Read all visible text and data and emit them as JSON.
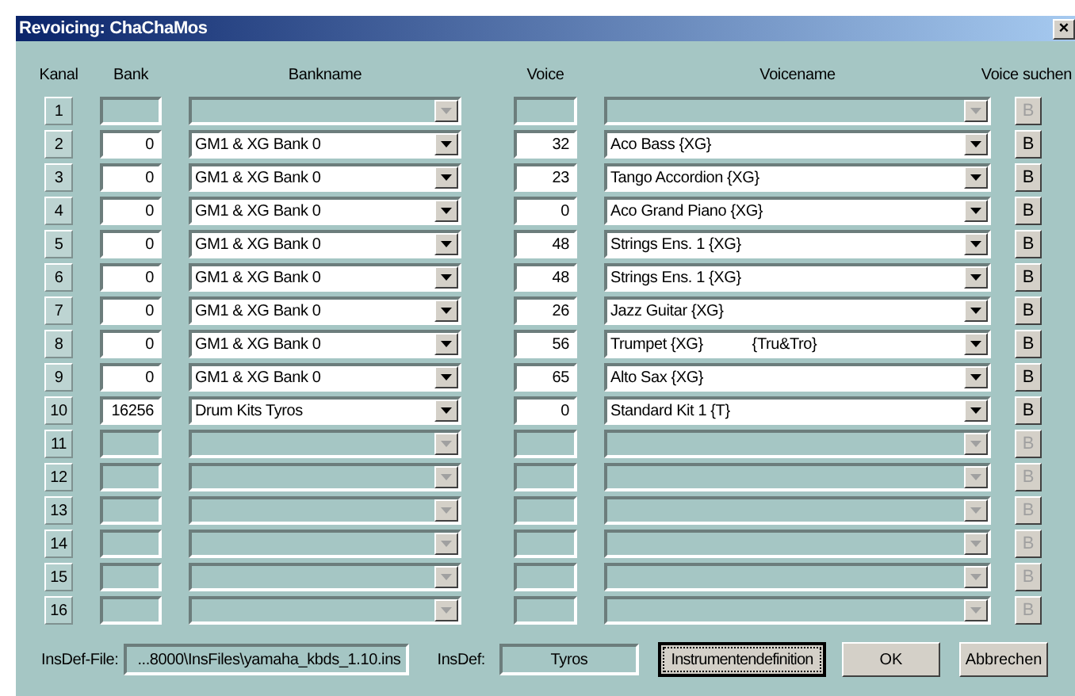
{
  "window": {
    "title": "Revoicing: ChaChaMos",
    "close": "×"
  },
  "columns": [
    "Kanal",
    "Bank",
    "Bankname",
    "Voice",
    "Voicename",
    "Voice suchen"
  ],
  "rows": [
    {
      "channel": "1",
      "disabled": true,
      "bank": "",
      "bankname": "",
      "voice": "",
      "voicename": "",
      "search": "B"
    },
    {
      "channel": "2",
      "disabled": false,
      "bank": "0",
      "bankname": "GM1 & XG Bank 0",
      "voice": "32",
      "voicename": "Aco Bass {XG}",
      "search": "B"
    },
    {
      "channel": "3",
      "disabled": false,
      "bank": "0",
      "bankname": "GM1 & XG Bank 0",
      "voice": "23",
      "voicename": "Tango Accordion {XG}",
      "search": "B"
    },
    {
      "channel": "4",
      "disabled": false,
      "bank": "0",
      "bankname": "GM1 & XG Bank 0",
      "voice": "0",
      "voicename": "Aco Grand Piano {XG}",
      "search": "B"
    },
    {
      "channel": "5",
      "disabled": false,
      "bank": "0",
      "bankname": "GM1 & XG Bank 0",
      "voice": "48",
      "voicename": "Strings Ens. 1 {XG}",
      "search": "B"
    },
    {
      "channel": "6",
      "disabled": false,
      "bank": "0",
      "bankname": "GM1 & XG Bank 0",
      "voice": "48",
      "voicename": "Strings Ens. 1 {XG}",
      "search": "B"
    },
    {
      "channel": "7",
      "disabled": false,
      "bank": "0",
      "bankname": "GM1 & XG Bank 0",
      "voice": "26",
      "voicename": "Jazz Guitar {XG}",
      "search": "B"
    },
    {
      "channel": "8",
      "disabled": false,
      "bank": "0",
      "bankname": "GM1 & XG Bank 0",
      "voice": "56",
      "voicename": "Trumpet {XG}            {Tru&Tro}",
      "search": "B"
    },
    {
      "channel": "9",
      "disabled": false,
      "bank": "0",
      "bankname": "GM1 & XG Bank 0",
      "voice": "65",
      "voicename": "Alto Sax {XG}",
      "search": "B"
    },
    {
      "channel": "10",
      "disabled": false,
      "bank": "16256",
      "bankname": "Drum Kits Tyros",
      "voice": "0",
      "voicename": "Standard Kit 1 {T}",
      "search": "B"
    },
    {
      "channel": "11",
      "disabled": true,
      "bank": "",
      "bankname": "",
      "voice": "",
      "voicename": "",
      "search": "B"
    },
    {
      "channel": "12",
      "disabled": true,
      "bank": "",
      "bankname": "",
      "voice": "",
      "voicename": "",
      "search": "B"
    },
    {
      "channel": "13",
      "disabled": true,
      "bank": "",
      "bankname": "",
      "voice": "",
      "voicename": "",
      "search": "B"
    },
    {
      "channel": "14",
      "disabled": true,
      "bank": "",
      "bankname": "",
      "voice": "",
      "voicename": "",
      "search": "B"
    },
    {
      "channel": "15",
      "disabled": true,
      "bank": "",
      "bankname": "",
      "voice": "",
      "voicename": "",
      "search": "B"
    },
    {
      "channel": "16",
      "disabled": true,
      "bank": "",
      "bankname": "",
      "voice": "",
      "voicename": "",
      "search": "B"
    }
  ],
  "footer": {
    "insdef_file_label": "InsDef-File:",
    "insdef_file": "...8000\\InsFiles\\yamaha_kbds_1.10.ins",
    "insdef_label": "InsDef:",
    "insdef": "Tyros",
    "buttons": [
      {
        "label": "Instrumentendefinition",
        "focused": true
      },
      {
        "label": "OK",
        "focused": false
      },
      {
        "label": "Abbrechen",
        "focused": false
      }
    ]
  }
}
